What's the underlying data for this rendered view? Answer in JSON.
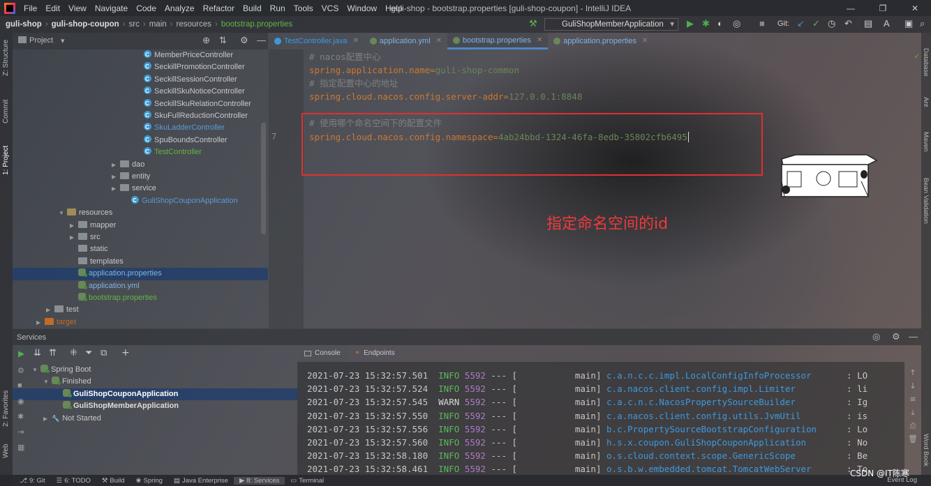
{
  "menubar": {
    "items": [
      "File",
      "Edit",
      "View",
      "Navigate",
      "Code",
      "Analyze",
      "Refactor",
      "Build",
      "Run",
      "Tools",
      "VCS",
      "Window",
      "Help"
    ],
    "window_title": "guli-shop - bootstrap.properties [guli-shop-coupon] - IntelliJ IDEA"
  },
  "navbar": {
    "breadcrumbs": [
      "guli-shop",
      "guli-shop-coupon",
      "src",
      "main",
      "resources",
      "bootstrap.properties"
    ],
    "run_config": "GuliShopMemberApplication",
    "git_label": "Git:"
  },
  "project_panel": {
    "title": "Project",
    "tree": [
      {
        "label": "MemberPriceController",
        "kind": "class",
        "color": "normal"
      },
      {
        "label": "SeckillPromotionController",
        "kind": "class",
        "color": "normal"
      },
      {
        "label": "SeckillSessionController",
        "kind": "class",
        "color": "normal"
      },
      {
        "label": "SeckillSkuNoticeController",
        "kind": "class",
        "color": "normal"
      },
      {
        "label": "SeckillSkuRelationController",
        "kind": "class",
        "color": "normal"
      },
      {
        "label": "SkuFullReductionController",
        "kind": "class",
        "color": "normal"
      },
      {
        "label": "SkuLadderController",
        "kind": "class",
        "color": "blue"
      },
      {
        "label": "SpuBoundsController",
        "kind": "class",
        "color": "normal"
      },
      {
        "label": "TestController",
        "kind": "class",
        "color": "green"
      },
      {
        "label": "dao",
        "kind": "folder",
        "color": "normal"
      },
      {
        "label": "entity",
        "kind": "folder",
        "color": "normal"
      },
      {
        "label": "service",
        "kind": "folder",
        "color": "normal"
      },
      {
        "label": "GuliShopCouponApplication",
        "kind": "app",
        "color": "blue"
      },
      {
        "label": "resources",
        "kind": "res",
        "color": "normal"
      },
      {
        "label": "mapper",
        "kind": "folder",
        "color": "normal"
      },
      {
        "label": "src",
        "kind": "folder",
        "color": "normal"
      },
      {
        "label": "static",
        "kind": "folder",
        "color": "normal"
      },
      {
        "label": "templates",
        "kind": "folder",
        "color": "normal"
      },
      {
        "label": "application.properties",
        "kind": "leaf",
        "color": "lblue"
      },
      {
        "label": "application.yml",
        "kind": "leaf",
        "color": "lblue"
      },
      {
        "label": "bootstrap.properties",
        "kind": "leaf",
        "color": "green"
      },
      {
        "label": "test",
        "kind": "folder",
        "color": "normal"
      },
      {
        "label": "target",
        "kind": "tgt",
        "color": "orange"
      }
    ]
  },
  "left_strip": [
    "Z: Structure",
    "Commit",
    "1: Project",
    "2: Favorites",
    "Web"
  ],
  "right_strip": [
    "Database",
    "Ant",
    "Maven",
    "Bean Validation",
    "Word Book"
  ],
  "editor": {
    "tabs": [
      {
        "label": "TestController.java",
        "color": "#3d9ad1",
        "active": false
      },
      {
        "label": "application.yml",
        "color": "#6a8759",
        "active": false
      },
      {
        "label": "bootstrap.properties",
        "color": "#6a8759",
        "active": true
      },
      {
        "label": "application.properties",
        "color": "#6a8759",
        "active": false
      }
    ],
    "line1_comment": "# nacos配置中心",
    "line2_key": "spring.application.name",
    "line2_val": "guli-shop-common",
    "line3_comment": "# 指定配置中心的地址",
    "line4_key": "spring.cloud.nacos.config.server-addr",
    "line4_val": "127.0.0.1:8848",
    "line6_comment": "# 使用哪个命名空间下的配置文件",
    "line7_key": "spring.cloud.nacos.config.namespace",
    "line7_val": "4ab24bbd-1324-46fa-8edb-35802cfb6495",
    "line7_number": "7",
    "equals": "="
  },
  "annotation": "指定命名空间的id",
  "services": {
    "title": "Services",
    "tree": [
      {
        "label": "Spring Boot",
        "indent": 1
      },
      {
        "label": "Finished",
        "indent": 2
      },
      {
        "label": "GuliShopCouponApplication",
        "indent": 3,
        "selected": true
      },
      {
        "label": "GuliShopMemberApplication",
        "indent": 3,
        "selected": false
      },
      {
        "label": "Not Started",
        "indent": 2
      }
    ],
    "console_tabs": [
      "Console",
      "Endpoints"
    ]
  },
  "console": {
    "lines": [
      {
        "ts": "2021-07-23 15:32:57.501",
        "level": "INFO",
        "pid": "5592",
        "thread": "main",
        "logger": "c.a.n.c.c.impl.LocalConfigInfoProcessor",
        "msg": ": LO"
      },
      {
        "ts": "2021-07-23 15:32:57.524",
        "level": "INFO",
        "pid": "5592",
        "thread": "main",
        "logger": "c.a.nacos.client.config.impl.Limiter",
        "msg": ": li"
      },
      {
        "ts": "2021-07-23 15:32:57.545",
        "level": "WARN",
        "pid": "5592",
        "thread": "main",
        "logger": "c.a.c.n.c.NacosPropertySourceBuilder",
        "msg": ": Ig"
      },
      {
        "ts": "2021-07-23 15:32:57.550",
        "level": "INFO",
        "pid": "5592",
        "thread": "main",
        "logger": "c.a.nacos.client.config.utils.JvmUtil",
        "msg": ": is"
      },
      {
        "ts": "2021-07-23 15:32:57.556",
        "level": "INFO",
        "pid": "5592",
        "thread": "main",
        "logger": "b.c.PropertySourceBootstrapConfiguration",
        "msg": ": Lo"
      },
      {
        "ts": "2021-07-23 15:32:57.560",
        "level": "INFO",
        "pid": "5592",
        "thread": "main",
        "logger": "h.s.x.coupon.GuliShopCouponApplication",
        "msg": ": No"
      },
      {
        "ts": "2021-07-23 15:32:58.180",
        "level": "INFO",
        "pid": "5592",
        "thread": "main",
        "logger": "o.s.cloud.context.scope.GenericScope",
        "msg": ": Be"
      },
      {
        "ts": "2021-07-23 15:32:58.461",
        "level": "INFO",
        "pid": "5592",
        "thread": "main",
        "logger": "o.s.b.w.embedded.tomcat.TomcatWebServer",
        "msg": ": To"
      }
    ]
  },
  "statusbar": {
    "items": [
      "9: Git",
      "6: TODO",
      "Build",
      "Spring",
      "Java Enterprise",
      "8: Services",
      "Terminal"
    ],
    "active": "8: Services",
    "event_log": "Event Log"
  },
  "watermark": "CSDN @IT陈寒"
}
